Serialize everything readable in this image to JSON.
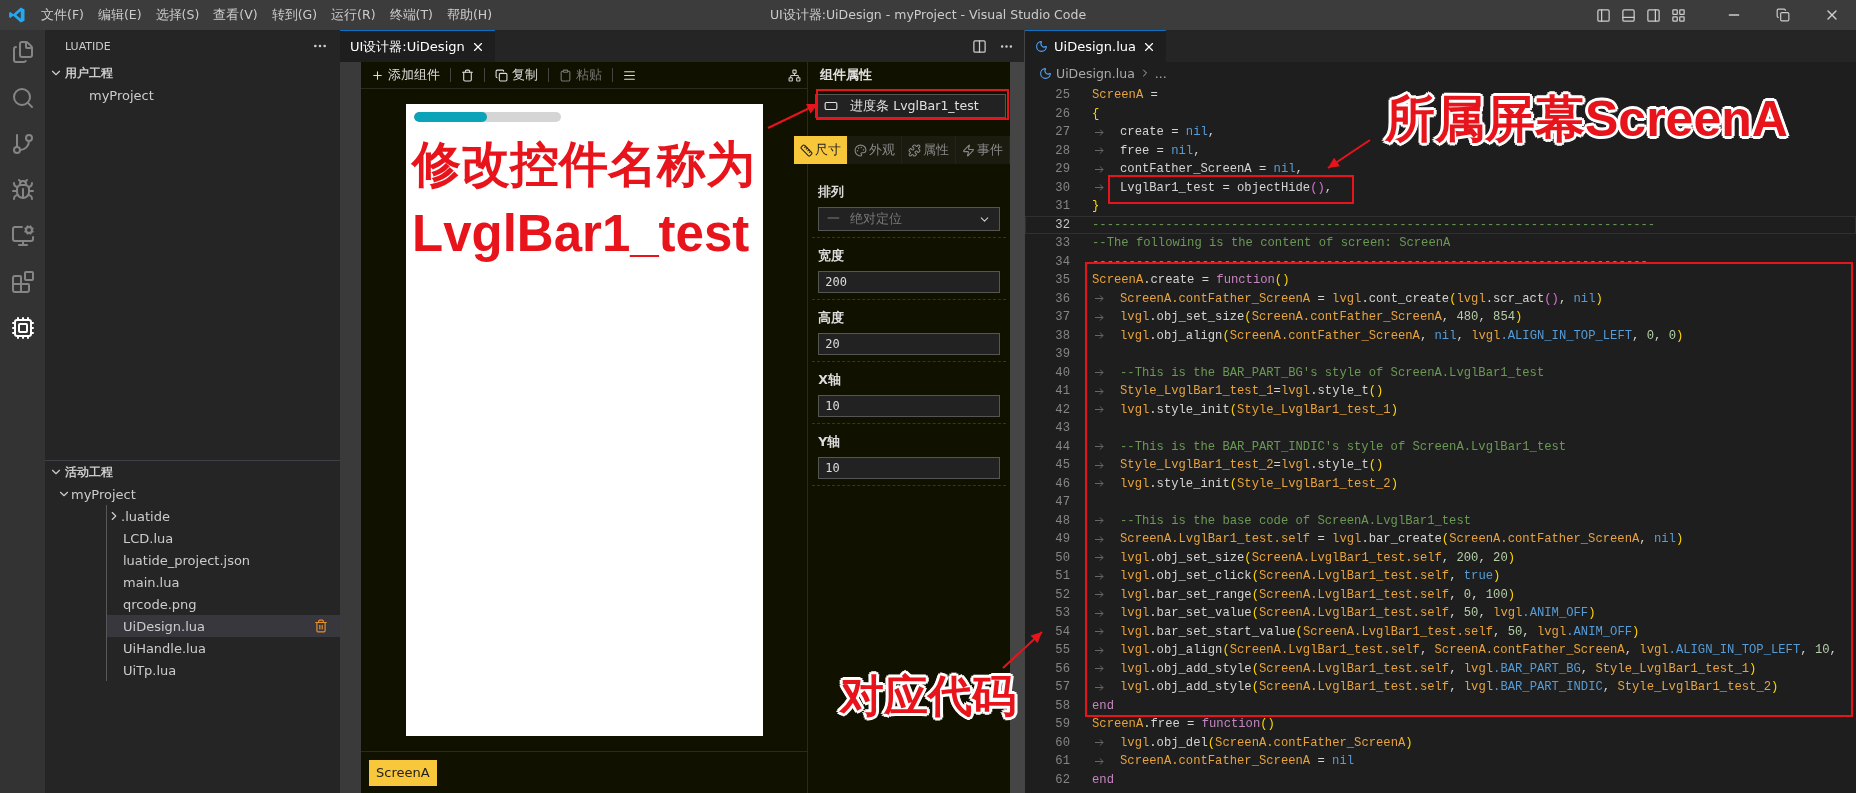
{
  "window": {
    "title": "UI设计器:UiDesign - myProject - Visual Studio Code"
  },
  "menu": [
    "文件(F)",
    "编辑(E)",
    "选择(S)",
    "查看(V)",
    "转到(G)",
    "运行(R)",
    "终端(T)",
    "帮助(H)"
  ],
  "sidebar": {
    "title": "LUATIDE",
    "sections": [
      {
        "title": "用户工程",
        "expanded": true,
        "items": [
          {
            "label": "myProject",
            "selected": false
          }
        ]
      },
      {
        "title": "活动工程",
        "expanded": true,
        "items": [
          {
            "label": "myProject",
            "expanded": true,
            "selected": false,
            "children": [
              {
                "label": ".luatide",
                "expanded": false,
                "selected": false
              },
              {
                "label": "LCD.lua",
                "selected": false
              },
              {
                "label": "luatide_project.json",
                "selected": false
              },
              {
                "label": "main.lua",
                "selected": false
              },
              {
                "label": "qrcode.png",
                "selected": false
              },
              {
                "label": "UiDesign.lua",
                "selected": true
              },
              {
                "label": "UiHandle.lua",
                "selected": false
              },
              {
                "label": "UiTp.lua",
                "selected": false
              }
            ]
          }
        ]
      }
    ]
  },
  "designer": {
    "tab": "UI设计器:UiDesign",
    "toolbar": [
      {
        "kind": "add",
        "label": "添加组件",
        "disabled": false
      },
      {
        "kind": "delete",
        "disabled": false
      },
      {
        "kind": "copy",
        "label": "复制",
        "disabled": false
      },
      {
        "kind": "paste",
        "label": "粘贴",
        "disabled": true
      },
      {
        "kind": "align",
        "disabled": false
      }
    ],
    "bar": {
      "level": 0.5
    },
    "screens": [
      {
        "label": "ScreenA",
        "selected": true
      }
    ],
    "properties": {
      "title": "组件属性",
      "component": "进度条 LvglBar1_test",
      "tabs": [
        {
          "label": "尺寸",
          "kind": "size",
          "selected": true
        },
        {
          "label": "外观",
          "kind": "look",
          "selected": false
        },
        {
          "label": "属性",
          "kind": "attr",
          "selected": false
        },
        {
          "label": "事件",
          "kind": "event",
          "selected": false
        }
      ],
      "layout": {
        "label": "排列",
        "prefix": "一",
        "value": "绝对定位",
        "disabled": true
      },
      "fields": [
        {
          "label": "宽度",
          "value": "200"
        },
        {
          "label": "高度",
          "value": "20"
        },
        {
          "label": "X轴",
          "value": "10"
        },
        {
          "label": "Y轴",
          "value": "10"
        }
      ]
    }
  },
  "editor": {
    "tab": "UiDesign.lua",
    "breadcrumb": [
      "UiDesign.lua",
      "..."
    ],
    "lines": [
      {
        "number": "25",
        "indented": false,
        "current": false,
        "tokens": [
          {
            "kind": "v",
            "text": "ScreenA"
          },
          {
            "kind": "p",
            "text": " = "
          }
        ]
      },
      {
        "number": "26",
        "indented": false,
        "current": false,
        "tokens": [
          {
            "kind": "b1",
            "text": "{"
          }
        ]
      },
      {
        "number": "27",
        "indented": true,
        "current": false,
        "tokens": [
          {
            "kind": "p",
            "text": "create = "
          },
          {
            "kind": "c",
            "text": "nil"
          },
          {
            "kind": "p",
            "text": ","
          }
        ]
      },
      {
        "number": "28",
        "indented": true,
        "current": false,
        "tokens": [
          {
            "kind": "p",
            "text": "free = "
          },
          {
            "kind": "c",
            "text": "nil"
          },
          {
            "kind": "p",
            "text": ","
          }
        ]
      },
      {
        "number": "29",
        "indented": true,
        "current": false,
        "tokens": [
          {
            "kind": "p",
            "text": "contFather_ScreenA = "
          },
          {
            "kind": "c",
            "text": "nil"
          },
          {
            "kind": "p",
            "text": ","
          }
        ]
      },
      {
        "number": "30",
        "indented": true,
        "current": false,
        "tokens": [
          {
            "kind": "p",
            "text": "LvglBar1_test = objectHide"
          },
          {
            "kind": "b2",
            "text": "()"
          },
          {
            "kind": "p",
            "text": ","
          }
        ]
      },
      {
        "number": "31",
        "indented": false,
        "current": false,
        "tokens": [
          {
            "kind": "b1",
            "text": "}"
          }
        ]
      },
      {
        "number": "32",
        "indented": false,
        "current": true,
        "tokens": [
          {
            "kind": "m",
            "text": "-----------------------------------------------------------------------------"
          }
        ]
      },
      {
        "number": "33",
        "indented": false,
        "current": false,
        "tokens": [
          {
            "kind": "m",
            "text": "--The following is the content of screen: ScreenA"
          }
        ]
      },
      {
        "number": "34",
        "indented": false,
        "current": false,
        "tokens": [
          {
            "kind": "m",
            "text": "----------------------------------------------------------------------------"
          }
        ]
      },
      {
        "number": "35",
        "indented": false,
        "current": false,
        "tokens": [
          {
            "kind": "v",
            "text": "ScreenA"
          },
          {
            "kind": "p",
            "text": ".create = "
          },
          {
            "kind": "k",
            "text": "function"
          },
          {
            "kind": "b1",
            "text": "()"
          }
        ]
      },
      {
        "number": "36",
        "indented": true,
        "current": false,
        "tokens": [
          {
            "kind": "v",
            "text": "ScreenA.contFather_ScreenA"
          },
          {
            "kind": "p",
            "text": " = "
          },
          {
            "kind": "v",
            "text": "lvgl"
          },
          {
            "kind": "p",
            "text": ".cont_create"
          },
          {
            "kind": "b1",
            "text": "("
          },
          {
            "kind": "v",
            "text": "lvgl"
          },
          {
            "kind": "p",
            "text": ".scr_act"
          },
          {
            "kind": "b2",
            "text": "()"
          },
          {
            "kind": "p",
            "text": ", "
          },
          {
            "kind": "c",
            "text": "nil"
          },
          {
            "kind": "b1",
            "text": ")"
          }
        ]
      },
      {
        "number": "37",
        "indented": true,
        "current": false,
        "tokens": [
          {
            "kind": "v",
            "text": "lvgl"
          },
          {
            "kind": "p",
            "text": ".obj_set_size"
          },
          {
            "kind": "b1",
            "text": "("
          },
          {
            "kind": "v",
            "text": "ScreenA.contFather_ScreenA"
          },
          {
            "kind": "p",
            "text": ", "
          },
          {
            "kind": "n",
            "text": "480"
          },
          {
            "kind": "p",
            "text": ", "
          },
          {
            "kind": "n",
            "text": "854"
          },
          {
            "kind": "b1",
            "text": ")"
          }
        ]
      },
      {
        "number": "38",
        "indented": true,
        "current": false,
        "tokens": [
          {
            "kind": "v",
            "text": "lvgl"
          },
          {
            "kind": "p",
            "text": ".obj_align"
          },
          {
            "kind": "b1",
            "text": "("
          },
          {
            "kind": "v",
            "text": "ScreenA.contFather_ScreenA"
          },
          {
            "kind": "p",
            "text": ", "
          },
          {
            "kind": "c",
            "text": "nil"
          },
          {
            "kind": "p",
            "text": ", "
          },
          {
            "kind": "v",
            "text": "lvgl"
          },
          {
            "kind": "c",
            "text": ".ALIGN_IN_TOP_LEFT"
          },
          {
            "kind": "p",
            "text": ", "
          },
          {
            "kind": "n",
            "text": "0"
          },
          {
            "kind": "p",
            "text": ", "
          },
          {
            "kind": "n",
            "text": "0"
          },
          {
            "kind": "b1",
            "text": ")"
          }
        ]
      },
      {
        "number": "39",
        "indented": false,
        "current": false
      },
      {
        "number": "40",
        "indented": true,
        "current": false,
        "tokens": [
          {
            "kind": "m",
            "text": "--This is the BAR_PART_BG's style of ScreenA.LvglBar1_test"
          }
        ]
      },
      {
        "number": "41",
        "indented": true,
        "current": false,
        "tokens": [
          {
            "kind": "v",
            "text": "Style_LvglBar1_test_1"
          },
          {
            "kind": "p",
            "text": "="
          },
          {
            "kind": "v",
            "text": "lvgl"
          },
          {
            "kind": "p",
            "text": ".style_t"
          },
          {
            "kind": "b1",
            "text": "()"
          }
        ]
      },
      {
        "number": "42",
        "indented": true,
        "current": false,
        "tokens": [
          {
            "kind": "v",
            "text": "lvgl"
          },
          {
            "kind": "p",
            "text": ".style_init"
          },
          {
            "kind": "b1",
            "text": "("
          },
          {
            "kind": "v",
            "text": "Style_LvglBar1_test_1"
          },
          {
            "kind": "b1",
            "text": ")"
          }
        ]
      },
      {
        "number": "43",
        "indented": false,
        "current": false
      },
      {
        "number": "44",
        "indented": true,
        "current": false,
        "tokens": [
          {
            "kind": "m",
            "text": "--This is the BAR_PART_INDIC's style of ScreenA.LvglBar1_test"
          }
        ]
      },
      {
        "number": "45",
        "indented": true,
        "current": false,
        "tokens": [
          {
            "kind": "v",
            "text": "Style_LvglBar1_test_2"
          },
          {
            "kind": "p",
            "text": "="
          },
          {
            "kind": "v",
            "text": "lvgl"
          },
          {
            "kind": "p",
            "text": ".style_t"
          },
          {
            "kind": "b1",
            "text": "()"
          }
        ]
      },
      {
        "number": "46",
        "indented": true,
        "current": false,
        "tokens": [
          {
            "kind": "v",
            "text": "lvgl"
          },
          {
            "kind": "p",
            "text": ".style_init"
          },
          {
            "kind": "b1",
            "text": "("
          },
          {
            "kind": "v",
            "text": "Style_LvglBar1_test_2"
          },
          {
            "kind": "b1",
            "text": ")"
          }
        ]
      },
      {
        "number": "47",
        "indented": false,
        "current": false
      },
      {
        "number": "48",
        "indented": true,
        "current": false,
        "tokens": [
          {
            "kind": "m",
            "text": "--This is the base code of ScreenA.LvglBar1_test"
          }
        ]
      },
      {
        "number": "49",
        "indented": true,
        "current": false,
        "tokens": [
          {
            "kind": "v",
            "text": "ScreenA.LvglBar1_test.self"
          },
          {
            "kind": "p",
            "text": " = "
          },
          {
            "kind": "v",
            "text": "lvgl"
          },
          {
            "kind": "p",
            "text": ".bar_create"
          },
          {
            "kind": "b1",
            "text": "("
          },
          {
            "kind": "v",
            "text": "ScreenA.contFather_ScreenA"
          },
          {
            "kind": "p",
            "text": ", "
          },
          {
            "kind": "c",
            "text": "nil"
          },
          {
            "kind": "b1",
            "text": ")"
          }
        ]
      },
      {
        "number": "50",
        "indented": true,
        "current": false,
        "tokens": [
          {
            "kind": "v",
            "text": "lvgl"
          },
          {
            "kind": "p",
            "text": ".obj_set_size"
          },
          {
            "kind": "b1",
            "text": "("
          },
          {
            "kind": "v",
            "text": "ScreenA.LvglBar1_test.self"
          },
          {
            "kind": "p",
            "text": ", "
          },
          {
            "kind": "n",
            "text": "200"
          },
          {
            "kind": "p",
            "text": ", "
          },
          {
            "kind": "n",
            "text": "20"
          },
          {
            "kind": "b1",
            "text": ")"
          }
        ]
      },
      {
        "number": "51",
        "indented": true,
        "current": false,
        "tokens": [
          {
            "kind": "v",
            "text": "lvgl"
          },
          {
            "kind": "p",
            "text": ".obj_set_click"
          },
          {
            "kind": "b1",
            "text": "("
          },
          {
            "kind": "v",
            "text": "ScreenA.LvglBar1_test.self"
          },
          {
            "kind": "p",
            "text": ", "
          },
          {
            "kind": "c",
            "text": "true"
          },
          {
            "kind": "b1",
            "text": ")"
          }
        ]
      },
      {
        "number": "52",
        "indented": true,
        "current": false,
        "tokens": [
          {
            "kind": "v",
            "text": "lvgl"
          },
          {
            "kind": "p",
            "text": ".bar_set_range"
          },
          {
            "kind": "b1",
            "text": "("
          },
          {
            "kind": "v",
            "text": "ScreenA.LvglBar1_test.self"
          },
          {
            "kind": "p",
            "text": ", "
          },
          {
            "kind": "n",
            "text": "0"
          },
          {
            "kind": "p",
            "text": ", "
          },
          {
            "kind": "n",
            "text": "100"
          },
          {
            "kind": "b1",
            "text": ")"
          }
        ]
      },
      {
        "number": "53",
        "indented": true,
        "current": false,
        "tokens": [
          {
            "kind": "v",
            "text": "lvgl"
          },
          {
            "kind": "p",
            "text": ".bar_set_value"
          },
          {
            "kind": "b1",
            "text": "("
          },
          {
            "kind": "v",
            "text": "ScreenA.LvglBar1_test.self"
          },
          {
            "kind": "p",
            "text": ", "
          },
          {
            "kind": "n",
            "text": "50"
          },
          {
            "kind": "p",
            "text": ", "
          },
          {
            "kind": "v",
            "text": "lvgl"
          },
          {
            "kind": "c",
            "text": ".ANIM_OFF"
          },
          {
            "kind": "b1",
            "text": ")"
          }
        ]
      },
      {
        "number": "54",
        "indented": true,
        "current": false,
        "tokens": [
          {
            "kind": "v",
            "text": "lvgl"
          },
          {
            "kind": "p",
            "text": ".bar_set_start_value"
          },
          {
            "kind": "b1",
            "text": "("
          },
          {
            "kind": "v",
            "text": "ScreenA.LvglBar1_test.self"
          },
          {
            "kind": "p",
            "text": ", "
          },
          {
            "kind": "n",
            "text": "50"
          },
          {
            "kind": "p",
            "text": ", "
          },
          {
            "kind": "v",
            "text": "lvgl"
          },
          {
            "kind": "c",
            "text": ".ANIM_OFF"
          },
          {
            "kind": "b1",
            "text": ")"
          }
        ]
      },
      {
        "number": "55",
        "indented": true,
        "current": false,
        "tokens": [
          {
            "kind": "v",
            "text": "lvgl"
          },
          {
            "kind": "p",
            "text": ".obj_align"
          },
          {
            "kind": "b1",
            "text": "("
          },
          {
            "kind": "v",
            "text": "ScreenA.LvglBar1_test.self"
          },
          {
            "kind": "p",
            "text": ", "
          },
          {
            "kind": "v",
            "text": "ScreenA.contFather_ScreenA"
          },
          {
            "kind": "p",
            "text": ", "
          },
          {
            "kind": "v",
            "text": "lvgl"
          },
          {
            "kind": "c",
            "text": ".ALIGN_IN_TOP_LEFT"
          },
          {
            "kind": "p",
            "text": ", "
          },
          {
            "kind": "n",
            "text": "10"
          },
          {
            "kind": "p",
            "text": ","
          }
        ]
      },
      {
        "number": "56",
        "indented": true,
        "current": false,
        "tokens": [
          {
            "kind": "v",
            "text": "lvgl"
          },
          {
            "kind": "p",
            "text": ".obj_add_style"
          },
          {
            "kind": "b1",
            "text": "("
          },
          {
            "kind": "v",
            "text": "ScreenA.LvglBar1_test.self"
          },
          {
            "kind": "p",
            "text": ", "
          },
          {
            "kind": "v",
            "text": "lvgl"
          },
          {
            "kind": "c",
            "text": ".BAR_PART_BG"
          },
          {
            "kind": "p",
            "text": ", "
          },
          {
            "kind": "v",
            "text": "Style_LvglBar1_test_1"
          },
          {
            "kind": "b1",
            "text": ")"
          }
        ]
      },
      {
        "number": "57",
        "indented": true,
        "current": false,
        "tokens": [
          {
            "kind": "v",
            "text": "lvgl"
          },
          {
            "kind": "p",
            "text": ".obj_add_style"
          },
          {
            "kind": "b1",
            "text": "("
          },
          {
            "kind": "v",
            "text": "ScreenA.LvglBar1_test.self"
          },
          {
            "kind": "p",
            "text": ", "
          },
          {
            "kind": "v",
            "text": "lvgl"
          },
          {
            "kind": "c",
            "text": ".BAR_PART_INDIC"
          },
          {
            "kind": "p",
            "text": ", "
          },
          {
            "kind": "v",
            "text": "Style_LvglBar1_test_2"
          },
          {
            "kind": "b1",
            "text": ")"
          }
        ]
      },
      {
        "number": "58",
        "indented": false,
        "current": false,
        "tokens": [
          {
            "kind": "k",
            "text": "end"
          }
        ]
      },
      {
        "number": "59",
        "indented": false,
        "current": false,
        "tokens": [
          {
            "kind": "v",
            "text": "ScreenA"
          },
          {
            "kind": "p",
            "text": ".free = "
          },
          {
            "kind": "k",
            "text": "function"
          },
          {
            "kind": "b1",
            "text": "()"
          }
        ]
      },
      {
        "number": "60",
        "indented": true,
        "current": false,
        "tokens": [
          {
            "kind": "v",
            "text": "lvgl"
          },
          {
            "kind": "p",
            "text": ".obj_del"
          },
          {
            "kind": "b1",
            "text": "("
          },
          {
            "kind": "v",
            "text": "ScreenA.contFather_ScreenA"
          },
          {
            "kind": "b1",
            "text": ")"
          }
        ]
      },
      {
        "number": "61",
        "indented": true,
        "current": false,
        "tokens": [
          {
            "kind": "v",
            "text": "ScreenA.contFather_ScreenA"
          },
          {
            "kind": "p",
            "text": " = "
          },
          {
            "kind": "c",
            "text": "nil"
          }
        ]
      },
      {
        "number": "62",
        "indented": false,
        "current": false,
        "tokens": [
          {
            "kind": "k",
            "text": "end"
          }
        ]
      }
    ]
  },
  "annotations": [
    {
      "text": "修改控件名称为"
    },
    {
      "text": "LvglBar1_test"
    },
    {
      "text": "所属屏幕ScreenA"
    },
    {
      "text": "对应代码"
    }
  ]
}
